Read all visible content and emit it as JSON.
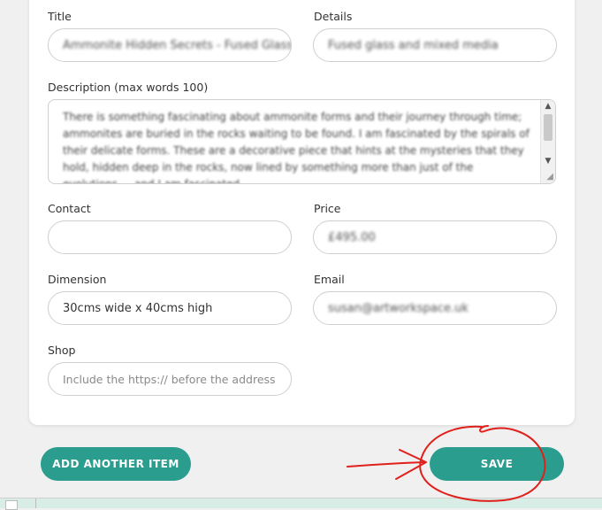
{
  "form": {
    "title_label": "Title",
    "title_value": "Ammonite Hidden Secrets - Fused Glass",
    "details_label": "Details",
    "details_value": "Fused glass and mixed media",
    "description_label": "Description (max words 100)",
    "description_value": "There is something fascinating about ammonite forms and their journey through time; ammonites are buried in the rocks waiting to be found. I am fascinated by the spirals of their delicate forms. These are a decorative piece that hints at the mysteries that they hold, hidden deep in the rocks, now lined by something more than just of the evolutions ... and I am fascinated.",
    "contact_label": "Contact",
    "contact_value": "",
    "price_label": "Price",
    "price_value": "£495.00",
    "dimension_label": "Dimension",
    "dimension_value": "30cms wide x 40cms  high",
    "email_label": "Email",
    "email_value": "susan@artworkspace.uk",
    "shop_label": "Shop",
    "shop_placeholder": "Include the https:// before the address"
  },
  "actions": {
    "add_another_label": "ADD ANOTHER ITEM",
    "save_label": "SAVE"
  },
  "colors": {
    "accent": "#2a9d8f",
    "annotation": "#e0201c"
  }
}
